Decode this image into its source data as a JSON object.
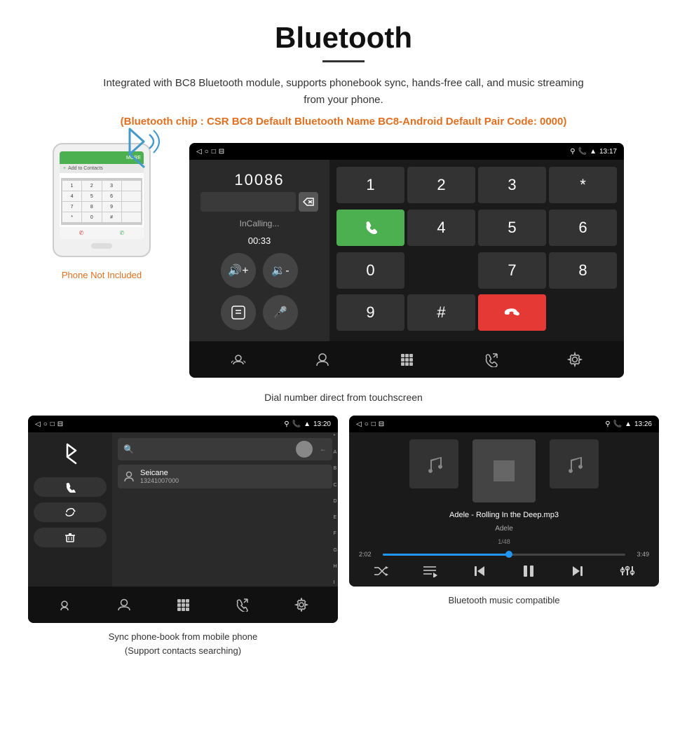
{
  "page": {
    "title": "Bluetooth",
    "subtitle": "Integrated with BC8 Bluetooth module, supports phonebook sync, hands-free call, and music streaming from your phone.",
    "bt_info": "(Bluetooth chip : CSR BC8    Default Bluetooth Name BC8-Android    Default Pair Code: 0000)",
    "phone_label": "Phone Not Included",
    "dial_caption": "Dial number direct from touchscreen",
    "phonebook_caption": "Sync phone-book from mobile phone\n(Support contacts searching)",
    "music_caption": "Bluetooth music compatible"
  },
  "dial_screen": {
    "statusbar_time": "13:17",
    "dial_number": "10086",
    "call_status": "InCalling...",
    "call_time": "00:33",
    "numpad_keys": [
      "1",
      "2",
      "3",
      "*",
      "4",
      "5",
      "6",
      "0",
      "7",
      "8",
      "9",
      "#"
    ]
  },
  "phonebook_screen": {
    "statusbar_time": "13:20",
    "contact_name": "Seicane",
    "contact_phone": "13241007000",
    "alphabet": [
      "*",
      "A",
      "B",
      "C",
      "D",
      "E",
      "F",
      "G",
      "H",
      "I"
    ]
  },
  "music_screen": {
    "statusbar_time": "13:26",
    "song_title": "Adele - Rolling In the Deep.mp3",
    "artist": "Adele",
    "track_info": "1/48",
    "time_current": "2:02",
    "time_total": "3:49",
    "progress_pct": 52
  }
}
